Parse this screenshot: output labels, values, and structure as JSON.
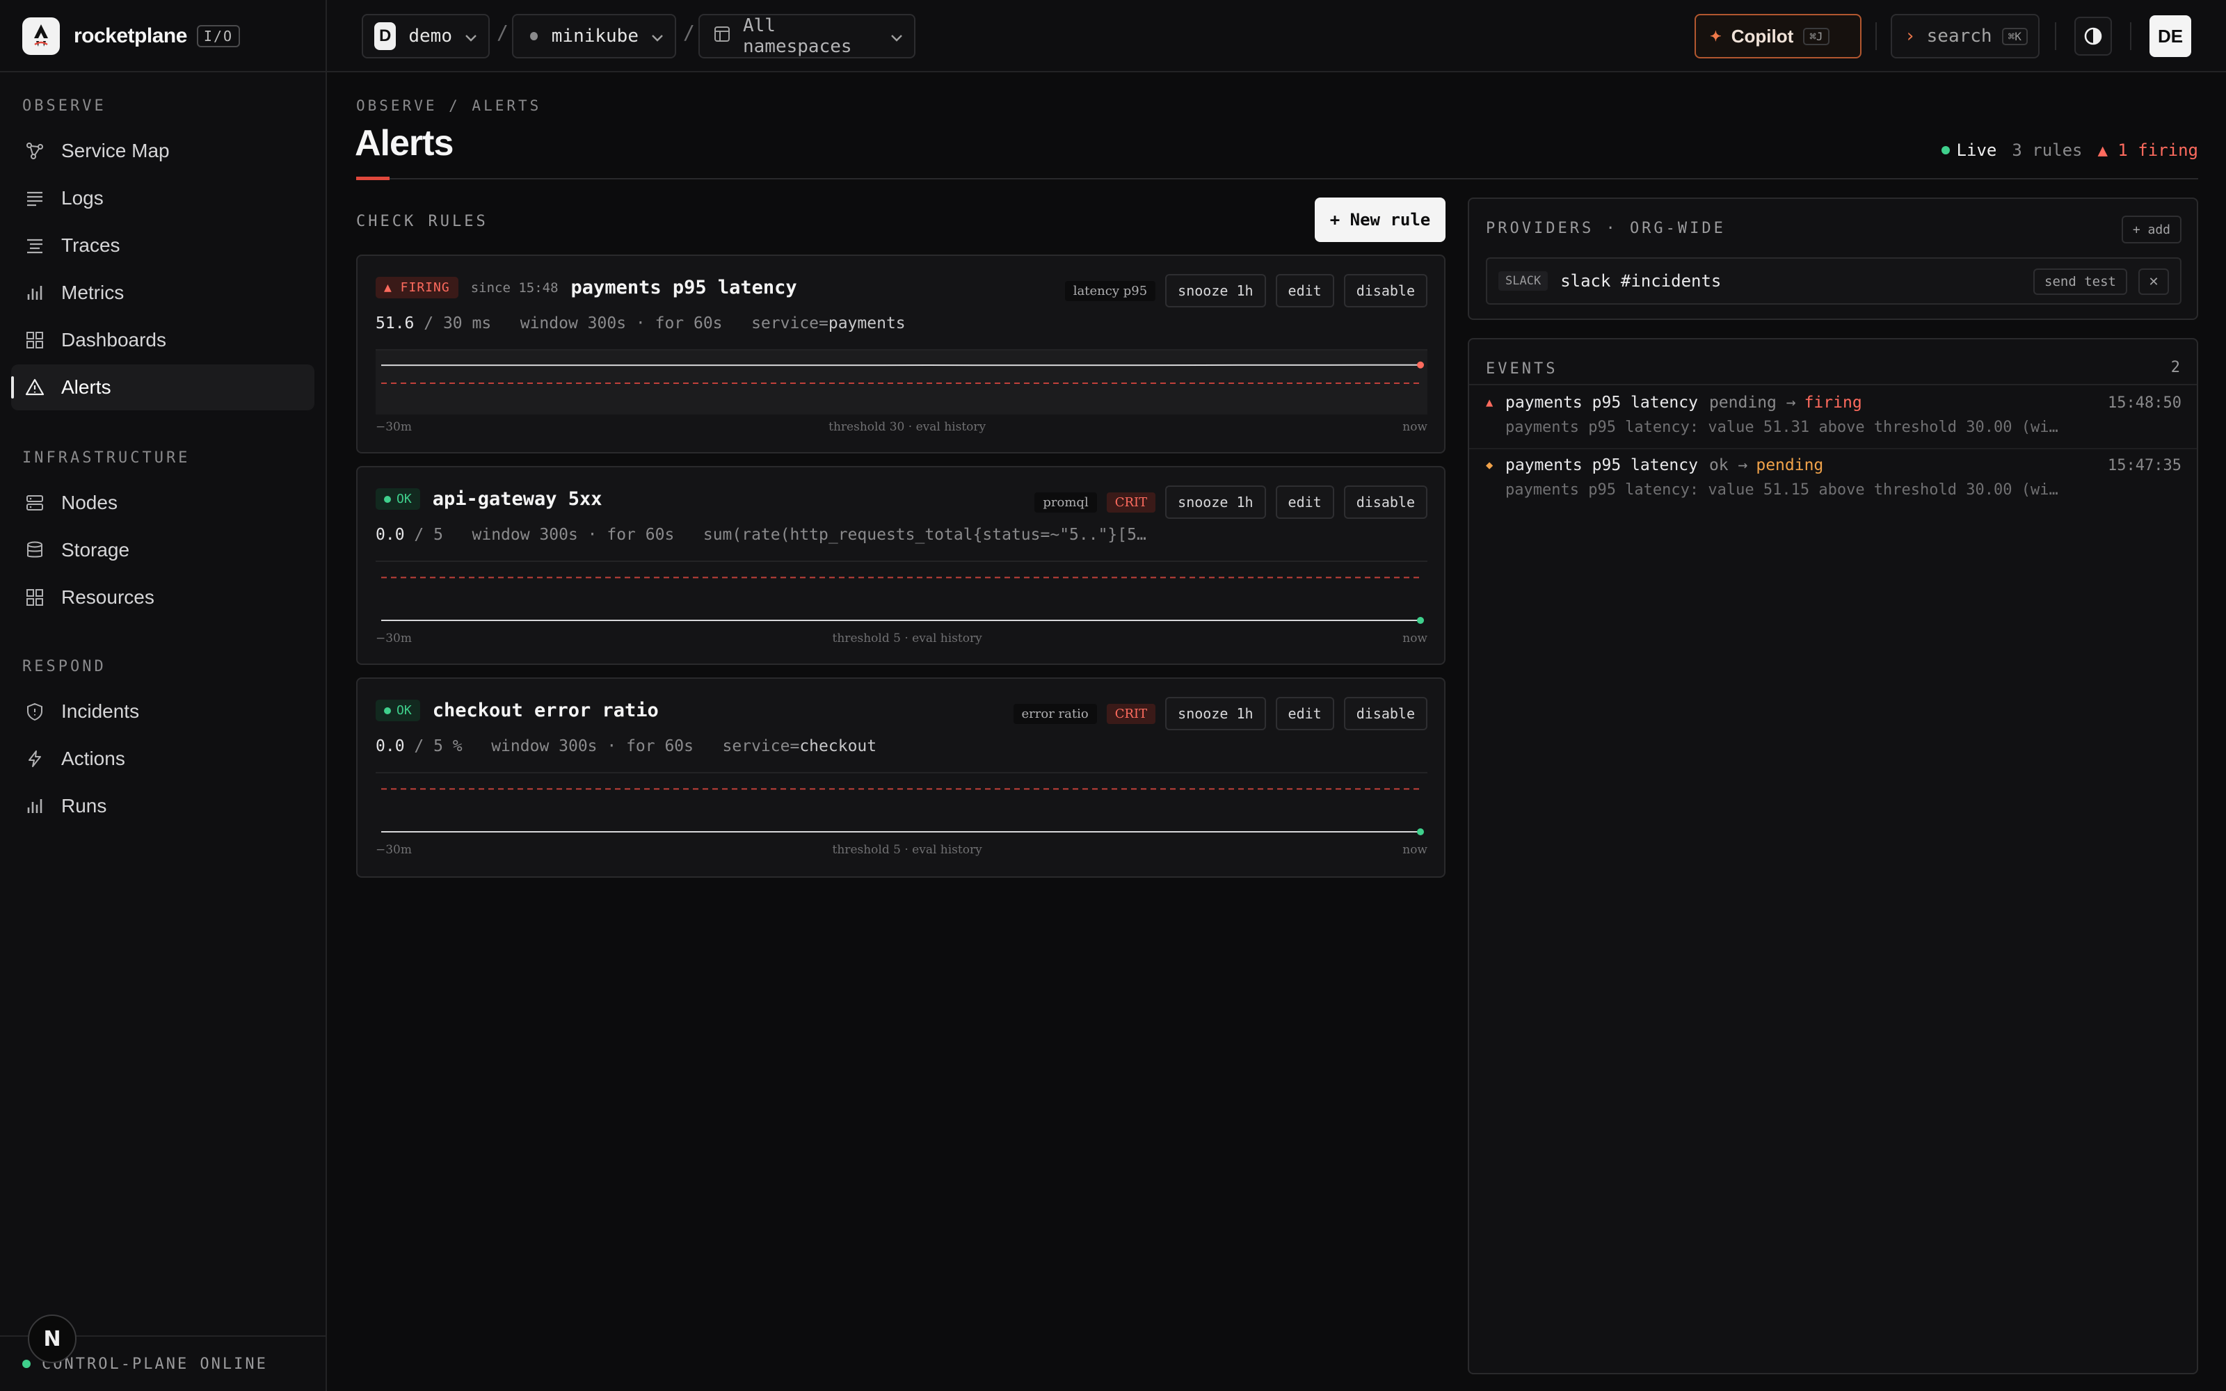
{
  "brand": {
    "name": "rocketplane",
    "tag": "I/O"
  },
  "context": {
    "org_initial": "D",
    "org": "demo",
    "cluster": "minikube",
    "namespace": "All namespaces"
  },
  "topbar": {
    "copilot_label": "Copilot",
    "copilot_kbd": "⌘J",
    "search_label": "search",
    "search_kbd": "⌘K",
    "user_initials": "DE"
  },
  "sidebar": {
    "sections": [
      {
        "title": "OBSERVE",
        "items": [
          {
            "label": "Service Map",
            "icon": "graph-icon"
          },
          {
            "label": "Logs",
            "icon": "lines-icon"
          },
          {
            "label": "Traces",
            "icon": "traces-icon"
          },
          {
            "label": "Metrics",
            "icon": "bar-chart-icon"
          },
          {
            "label": "Dashboards",
            "icon": "grid-icon"
          },
          {
            "label": "Alerts",
            "icon": "warning-icon",
            "active": true
          }
        ]
      },
      {
        "title": "INFRASTRUCTURE",
        "items": [
          {
            "label": "Nodes",
            "icon": "server-icon"
          },
          {
            "label": "Storage",
            "icon": "database-icon"
          },
          {
            "label": "Resources",
            "icon": "grid-icon"
          }
        ]
      },
      {
        "title": "RESPOND",
        "items": [
          {
            "label": "Incidents",
            "icon": "shield-icon"
          },
          {
            "label": "Actions",
            "icon": "bolt-icon"
          },
          {
            "label": "Runs",
            "icon": "bar-chart-icon"
          }
        ]
      }
    ],
    "status": "CONTROL-PLANE ONLINE",
    "badge": "N"
  },
  "page": {
    "breadcrumb": "OBSERVE / ALERTS",
    "title": "Alerts",
    "live": "Live",
    "rules_count": "3 rules",
    "firing_count": "▲ 1 firing"
  },
  "rules_section": {
    "title": "CHECK RULES",
    "new_rule": "+ New rule"
  },
  "rules": [
    {
      "state": "▲ FIRING",
      "since": "since 15:48",
      "name": "payments p95 latency",
      "tag": "latency p95",
      "crit": "",
      "snooze": "snooze 1h",
      "edit": "edit",
      "disable": "disable",
      "value": "51.6",
      "threshold": "/ 30 ms",
      "window": "window 300s · for 60s",
      "selector_key": "service=",
      "selector_val": "payments",
      "foot_left": "−30m",
      "foot_mid": "threshold 30 · eval history",
      "foot_right": "now",
      "history": [
        51.0,
        51.0,
        51.0,
        51.0,
        51.0,
        51.0,
        51.0,
        51.0,
        51.0,
        51.0,
        51.1,
        51.0,
        51.0,
        51.0,
        51.0,
        51.1,
        51.2,
        51.2,
        51.3,
        51.3
      ],
      "threshold_value": 30,
      "ylim": [
        0,
        60
      ]
    },
    {
      "state": "OK",
      "since": "",
      "name": "api-gateway 5xx",
      "tag": "promql",
      "crit": "CRIT",
      "snooze": "snooze 1h",
      "edit": "edit",
      "disable": "disable",
      "value": "0.0",
      "threshold": "/ 5",
      "window": "window 300s · for 60s",
      "selector_key": "",
      "selector_val": "sum(rate(http_requests_total{status=~\"5..\"}[5…",
      "foot_left": "−30m",
      "foot_mid": "threshold 5 · eval history",
      "foot_right": "now",
      "history": [
        0,
        0,
        0,
        0,
        0,
        0,
        0,
        0,
        0,
        0,
        0,
        0,
        0,
        0,
        0,
        0,
        0,
        0,
        0,
        0
      ],
      "threshold_value": 5,
      "ylim": [
        0,
        6
      ]
    },
    {
      "state": "OK",
      "since": "",
      "name": "checkout error ratio",
      "tag": "error ratio",
      "crit": "CRIT",
      "snooze": "snooze 1h",
      "edit": "edit",
      "disable": "disable",
      "value": "0.0",
      "threshold": "/ 5 %",
      "window": "window 300s · for 60s",
      "selector_key": "service=",
      "selector_val": "checkout",
      "foot_left": "−30m",
      "foot_mid": "threshold 5 · eval history",
      "foot_right": "now",
      "history": [
        0,
        0,
        0,
        0,
        0,
        0,
        0,
        0,
        0,
        0,
        0,
        0,
        0,
        0,
        0,
        0,
        0,
        0,
        0,
        0
      ],
      "threshold_value": 5,
      "ylim": [
        0,
        6
      ]
    }
  ],
  "providers": {
    "title": "PROVIDERS · ORG-WIDE",
    "add": "+ add",
    "items": [
      {
        "type": "SLACK",
        "name": "slack #incidents",
        "send_test": "send test",
        "remove": "✕"
      }
    ]
  },
  "events": {
    "title": "EVENTS",
    "count": "2",
    "items": [
      {
        "icon": "▲",
        "name": "payments p95 latency",
        "from": "pending →",
        "to": "firing",
        "time": "15:48:50",
        "detail": "payments p95 latency: value 51.31 above threshold 30.00 (wi…"
      },
      {
        "icon": "◆",
        "name": "payments p95 latency",
        "from": "ok →",
        "to": "pending",
        "time": "15:47:35",
        "detail": "payments p95 latency: value 51.15 above threshold 30.00 (wi…"
      }
    ]
  },
  "colors": {
    "firing": "#ff6b5e",
    "ok": "#3fd08c",
    "pending": "#f0a24a",
    "accent": "#e0483c"
  }
}
